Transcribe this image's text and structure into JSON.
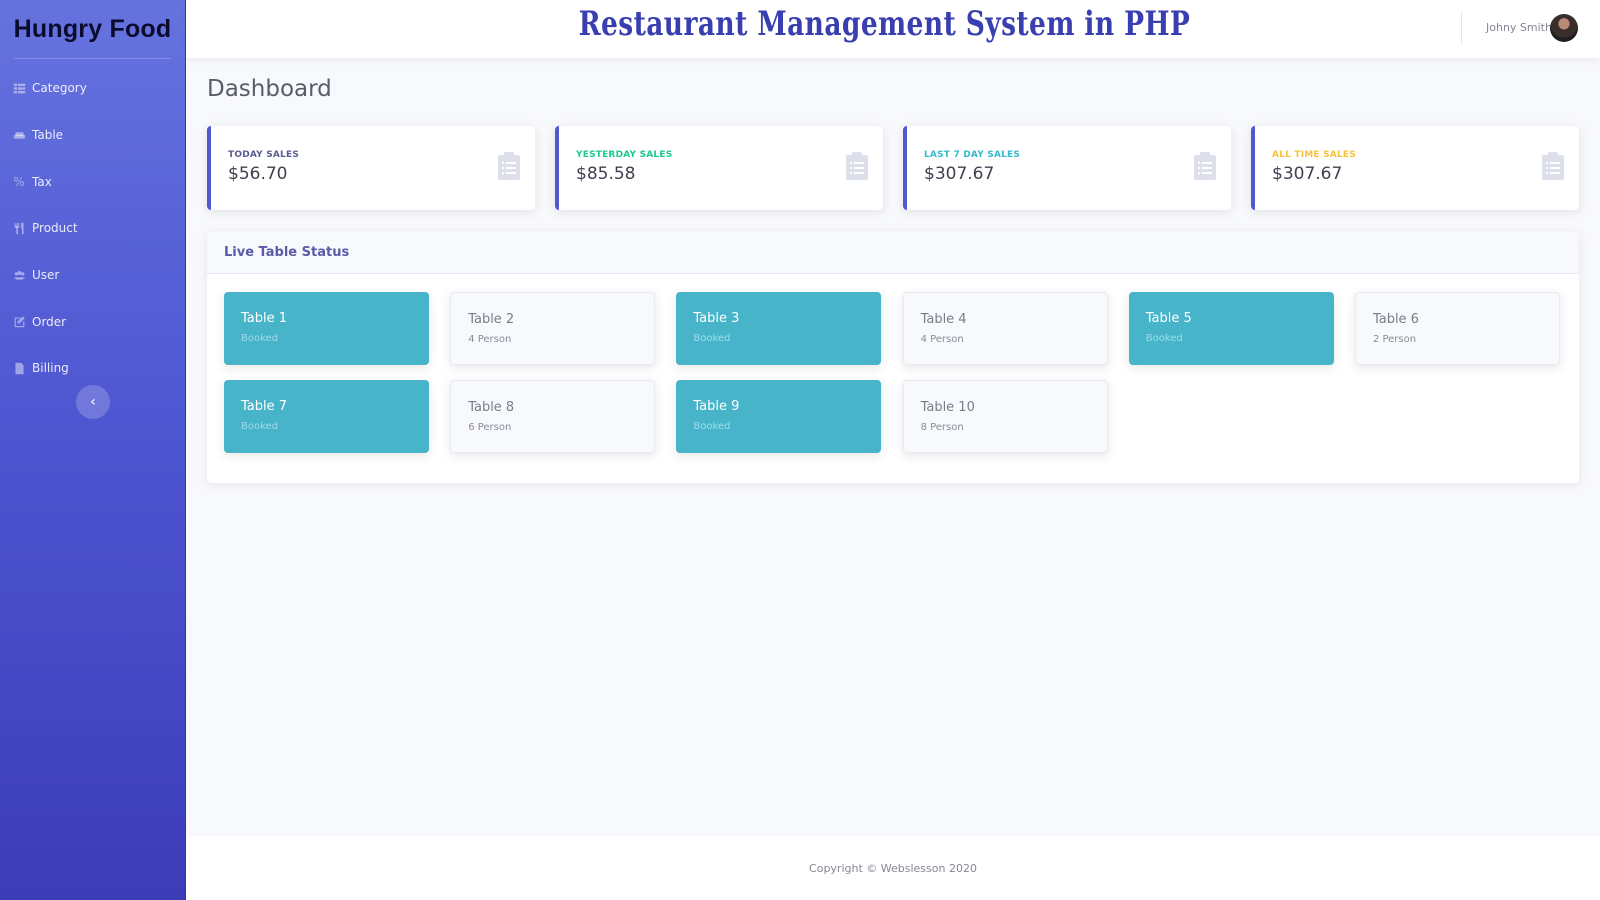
{
  "sidebar": {
    "brand": "Hungry Food",
    "items": [
      {
        "label": "Category",
        "icon": "list-icon"
      },
      {
        "label": "Table",
        "icon": "couch-icon"
      },
      {
        "label": "Tax",
        "icon": "percent-icon"
      },
      {
        "label": "Product",
        "icon": "utensils-icon"
      },
      {
        "label": "User",
        "icon": "users-icon"
      },
      {
        "label": "Order",
        "icon": "edit-icon"
      },
      {
        "label": "Billing",
        "icon": "file-invoice-icon"
      }
    ],
    "toggle_glyph": "‹"
  },
  "topbar": {
    "title": "Restaurant Management System in PHP",
    "user_name": "Johny Smith"
  },
  "main": {
    "page_title": "Dashboard",
    "stats": [
      {
        "label": "Today Sales",
        "value": "$56.70",
        "color": "#5a5c8f"
      },
      {
        "label": "Yesterday Sales",
        "value": "$85.58",
        "color": "#1cc88a"
      },
      {
        "label": "Last 7 Day Sales",
        "value": "$307.67",
        "color": "#36b9cc"
      },
      {
        "label": "All Time Sales",
        "value": "$307.67",
        "color": "#f6c23e"
      }
    ],
    "live_status": {
      "title": "Live Table Status",
      "tables": [
        {
          "name": "Table 1",
          "status": "Booked",
          "booked": true
        },
        {
          "name": "Table 2",
          "status": "4 Person",
          "booked": false
        },
        {
          "name": "Table 3",
          "status": "Booked",
          "booked": true
        },
        {
          "name": "Table 4",
          "status": "4 Person",
          "booked": false
        },
        {
          "name": "Table 5",
          "status": "Booked",
          "booked": true
        },
        {
          "name": "Table 6",
          "status": "2 Person",
          "booked": false
        },
        {
          "name": "Table 7",
          "status": "Booked",
          "booked": true
        },
        {
          "name": "Table 8",
          "status": "6 Person",
          "booked": false
        },
        {
          "name": "Table 9",
          "status": "Booked",
          "booked": true
        },
        {
          "name": "Table 10",
          "status": "8 Person",
          "booked": false
        }
      ]
    }
  },
  "footer": {
    "copyright": "Copyright © Webslesson 2020"
  }
}
